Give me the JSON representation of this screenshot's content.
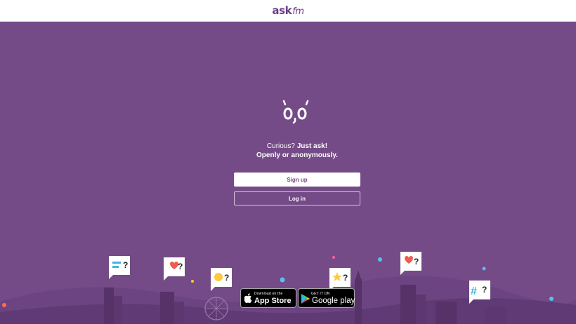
{
  "header": {
    "logo_main": "ask",
    "logo_suffix": "fm"
  },
  "hero": {
    "tagline_plain": "Curious?",
    "tagline_bold": "Just ask!",
    "tagline_second": "Openly or anonymously."
  },
  "actions": {
    "signup_label": "Sign up",
    "login_label": "Log in"
  },
  "stores": {
    "apple_small": "Download on the",
    "apple_big": "App Store",
    "google_small": "GET IT ON",
    "google_big": "Google play"
  },
  "colors": {
    "background": "#744b87",
    "logo": "#6b3c87",
    "white": "#ffffff"
  },
  "icons": [
    "app-logo",
    "mascot-eyes-icon",
    "apple-icon",
    "google-play-icon",
    "speech-bubble-icons",
    "city-skyline-illustration"
  ]
}
